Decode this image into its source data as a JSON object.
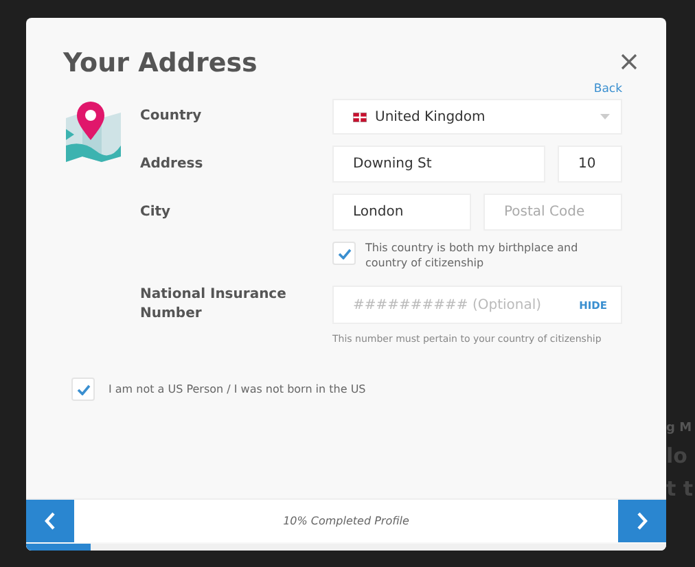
{
  "dialog": {
    "title": "Your Address",
    "back_link": "Back"
  },
  "country": {
    "label": "Country",
    "value": "United Kingdom"
  },
  "address": {
    "label": "Address",
    "street": {
      "value": "Downing St"
    },
    "number": {
      "value": "10"
    }
  },
  "city": {
    "label": "City",
    "city": {
      "value": "London"
    },
    "postal_code": {
      "placeholder": "Postal Code"
    }
  },
  "birthplace_checkbox": {
    "label": "This country is both my birthplace and country of citizenship",
    "checked": true
  },
  "national_insurance": {
    "label": "National Insurance Number",
    "placeholder": "########## (Optional)",
    "toggle": "HIDE",
    "hint": "This number must pertain to your country of citizenship"
  },
  "us_person_checkbox": {
    "label": "I am not a US Person / I was not born in the US",
    "checked": true
  },
  "footer": {
    "progress_text": "10% Completed Profile",
    "level": 0.1
  },
  "background_fragments": [
    "g M",
    "lo",
    "t t"
  ]
}
